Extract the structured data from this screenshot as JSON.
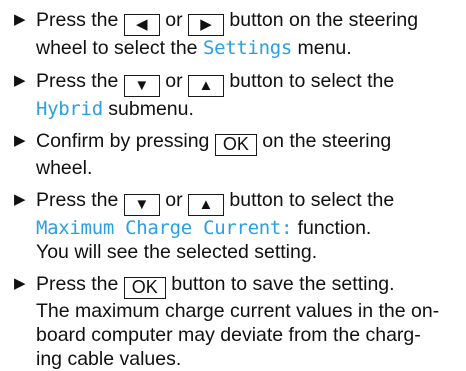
{
  "steps": [
    {
      "a": "Press the",
      "btn1_icon": "◀",
      "or": "or",
      "btn2_icon": "▶",
      "b": "button on the steering",
      "c": "wheel to select the",
      "menu": "Settings",
      "d": "menu."
    },
    {
      "a": "Press the",
      "btn1_icon": "▼",
      "or": "or",
      "btn2_icon": "▲",
      "b": "button to select the",
      "menu": "Hybrid",
      "c": "submenu."
    },
    {
      "a": "Confirm by pressing",
      "btn": "OK",
      "b": "on the steering",
      "c": "wheel."
    },
    {
      "a": "Press the",
      "btn1_icon": "▼",
      "or": "or",
      "btn2_icon": "▲",
      "b": "button to select the",
      "function": "Maximum Charge Current:",
      "c": "function.",
      "d": "You will see the selected setting."
    },
    {
      "a": "Press the",
      "btn": "OK",
      "b": "button to save the setting.",
      "c": "The maximum charge current values in the on-",
      "d": "board computer may deviate from the charg-",
      "e": "ing cable values."
    }
  ],
  "icons": {
    "bullet": "▶",
    "left_button": "left-arrow",
    "right_button": "right-arrow",
    "down_button": "down-arrow",
    "up_button": "up-arrow"
  },
  "colors": {
    "display_text": "#2aa0e0"
  }
}
